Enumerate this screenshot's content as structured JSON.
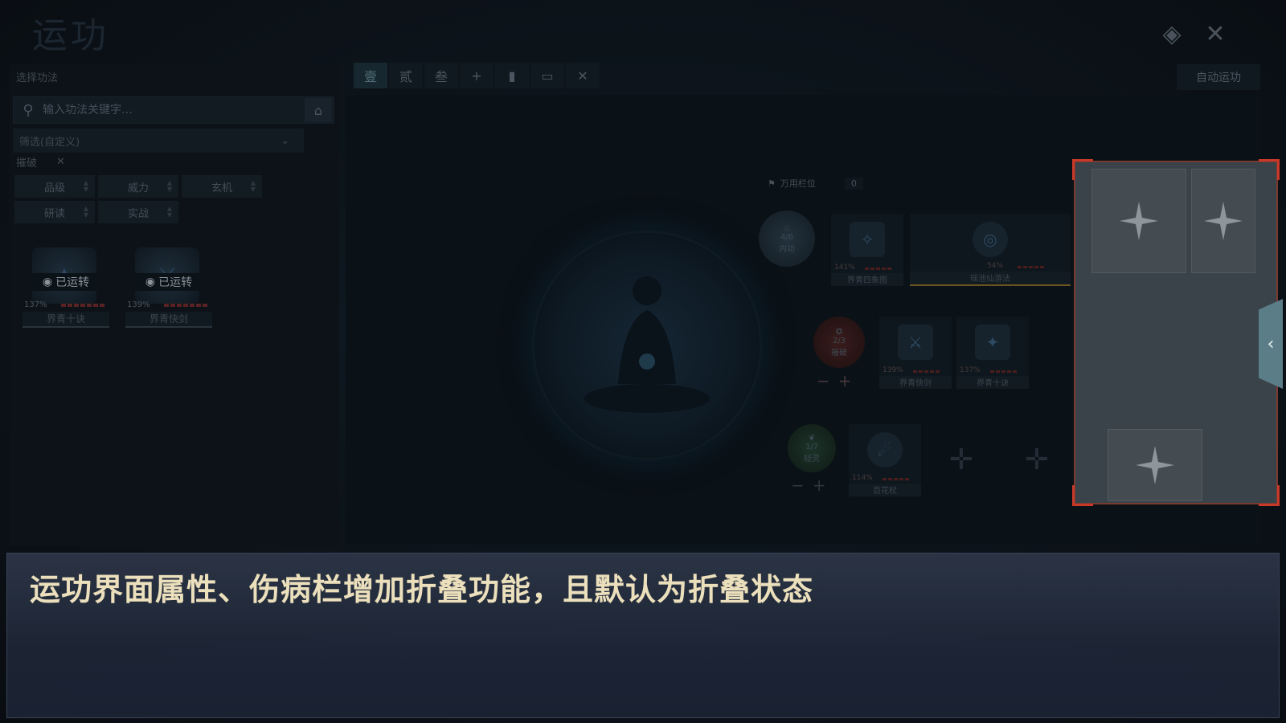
{
  "title": "运功",
  "left_panel": {
    "header": "选择功法",
    "search_placeholder": "输入功法关键字…",
    "filter_label": "筛选(自定义)",
    "tag_label": "摧破",
    "sort_buttons": [
      "品级",
      "威力",
      "玄机",
      "研读",
      "实战"
    ],
    "skills": [
      {
        "badge": "已运转",
        "percent": "137%",
        "name": "界青十诀"
      },
      {
        "badge": "已运转",
        "percent": "139%",
        "name": "界青快剑"
      }
    ]
  },
  "tabs": [
    "壹",
    "贰",
    "叁",
    "+",
    "▮",
    "▭",
    "✕"
  ],
  "auto_button": "自动运功",
  "wanyong": {
    "label": "万用栏位",
    "count": "0"
  },
  "core_slots": [
    {
      "fraction": "4/6",
      "label": "内功"
    },
    {
      "fraction": "2/3",
      "label": "摧破"
    },
    {
      "fraction": "1/7",
      "label": "轻灵"
    }
  ],
  "cards": [
    {
      "percent": "141%",
      "name": "界青四象图"
    },
    {
      "percent": "54%",
      "name": "瑶池仙游法"
    },
    {
      "percent": "139%",
      "name": "界青快剑"
    },
    {
      "percent": "137%",
      "name": "界青十诀"
    },
    {
      "percent": "114%",
      "name": "百花杖"
    }
  ],
  "caption": "运功界面属性、伤病栏增加折叠功能，且默认为折叠状态",
  "colors": {
    "accent_red": "#c9392a",
    "caption_text": "#f3e6c2",
    "collapse_tab": "#5b7d88"
  }
}
